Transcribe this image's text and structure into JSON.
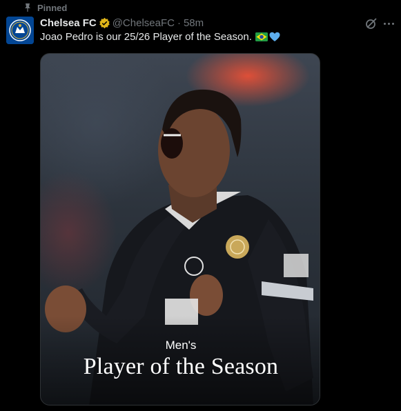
{
  "pinned": {
    "label": "Pinned",
    "icon": "pin-icon"
  },
  "author": {
    "name": "Chelsea FC",
    "handle": "@ChelseaFC",
    "separator": "·",
    "time": "58m",
    "avatar_icon": "chelsea-crest",
    "verified_icon": "verified-gold-badge",
    "verified_color": "#e2b719"
  },
  "tweet": {
    "text": "Joao Pedro is our 25/26 Player of the Season.",
    "emoji": [
      "brazil-flag",
      "blue-heart"
    ]
  },
  "media": {
    "caption_small": "Men's",
    "caption_large": "Player of the Season",
    "alt": "photo"
  },
  "colors": {
    "background": "#000000",
    "primary_text": "#e7e9ea",
    "secondary_text": "#71767b",
    "chelsea_blue": "#034694"
  }
}
